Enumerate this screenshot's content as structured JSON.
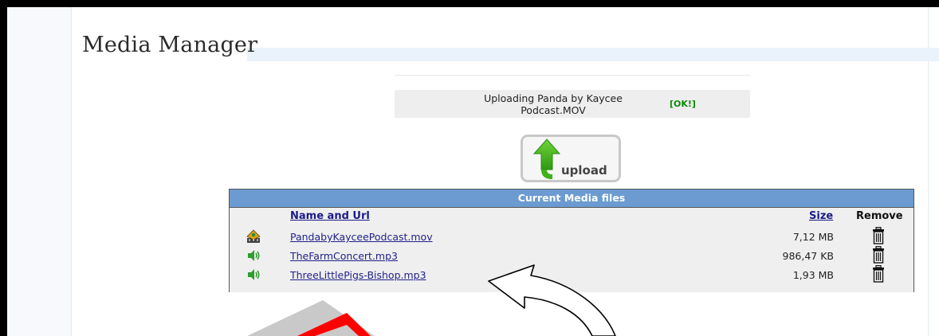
{
  "page": {
    "title": "Media Manager"
  },
  "upload_status": {
    "message": "Uploading Panda by Kaycee Podcast.MOV",
    "badge": "[OK!]"
  },
  "upload_button": {
    "label": "upload",
    "icon": "green-up-arrow-icon"
  },
  "media_table": {
    "caption": "Current Media files",
    "columns": {
      "name": "Name and Url",
      "size": "Size",
      "remove": "Remove"
    },
    "rows": [
      {
        "icon": "video-file-icon",
        "name": "PandabyKayceePodcast.mov",
        "size": "7,12 MB",
        "remove_icon": "trash-icon"
      },
      {
        "icon": "audio-speaker-icon",
        "name": "TheFarmConcert.mp3",
        "size": "986,47 KB",
        "remove_icon": "trash-icon"
      },
      {
        "icon": "audio-speaker-icon",
        "name": "ThreeLittlePigs-Bishop.mp3",
        "size": "1,93 MB",
        "remove_icon": "trash-icon"
      }
    ]
  },
  "colors": {
    "header_bg": "#6b9bd1",
    "link": "#1f1f8a",
    "ok_green": "#0a8a0a",
    "arrow_green": "#3fb21a",
    "annotation_red": "#ff0000"
  }
}
